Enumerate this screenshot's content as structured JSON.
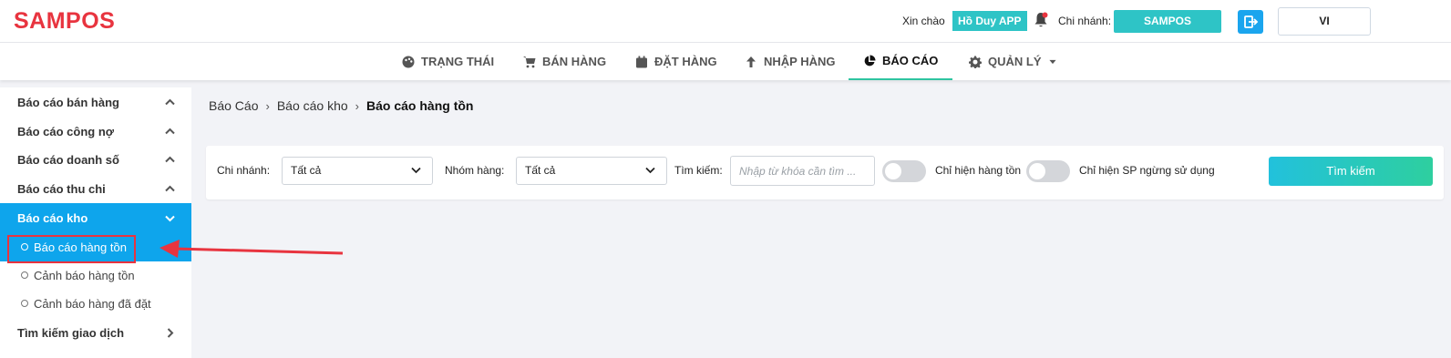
{
  "brand": {
    "logo": "SAMPOS",
    "logo_color": "#e8343f"
  },
  "header": {
    "greeting": "Xin chào",
    "user_name": "Hồ Duy APP",
    "branch_label": "Chi nhánh:",
    "branch_value": "SAMPOS",
    "language": "VI",
    "accent": "#2ec4c6"
  },
  "nav": {
    "items": [
      {
        "label": "TRẠNG THÁI",
        "icon": "palette-icon"
      },
      {
        "label": "BÁN HÀNG",
        "icon": "cart-icon"
      },
      {
        "label": "ĐẶT HÀNG",
        "icon": "calendar-icon"
      },
      {
        "label": "NHẬP HÀNG",
        "icon": "arrow-up-icon"
      },
      {
        "label": "BÁO CÁO",
        "icon": "pie-chart-icon",
        "active": true
      },
      {
        "label": "QUẢN LÝ",
        "icon": "gear-icon"
      }
    ]
  },
  "sidebar": {
    "items": [
      {
        "label": "Báo cáo bán hàng"
      },
      {
        "label": "Báo cáo công nợ"
      },
      {
        "label": "Báo cáo doanh số"
      },
      {
        "label": "Báo cáo thu chi"
      },
      {
        "label": "Báo cáo kho",
        "active": true
      }
    ],
    "sub_items": [
      {
        "label": "Báo cáo hàng tồn",
        "active": true
      },
      {
        "label": "Cảnh báo hàng tồn"
      },
      {
        "label": "Cảnh báo hàng đã đặt"
      }
    ],
    "last_item": {
      "label": "Tìm kiếm giao dịch"
    },
    "active_color": "#0ea5ec"
  },
  "breadcrumb": {
    "items": [
      "Báo Cáo",
      "Báo cáo kho",
      "Báo cáo hàng tồn"
    ]
  },
  "filter": {
    "branch_label": "Chi nhánh:",
    "branch_value": "Tất cả",
    "group_label": "Nhóm hàng:",
    "group_value": "Tất cả",
    "search_label": "Tìm kiếm:",
    "search_placeholder": "Nhập từ khóa cần tìm ...",
    "toggle1_label": "Chỉ hiện hàng tồn",
    "toggle1_on": false,
    "toggle2_label": "Chỉ hiện SP ngừng sử dụng",
    "toggle2_on": false,
    "search_button": "Tìm kiếm"
  }
}
